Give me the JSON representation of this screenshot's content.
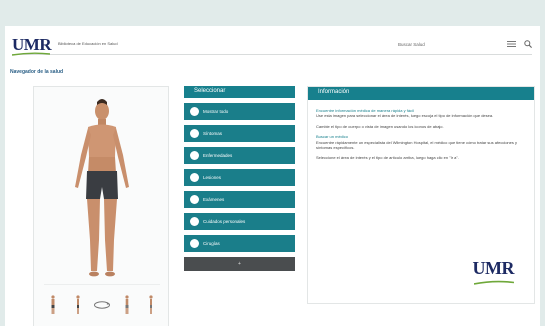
{
  "header": {
    "logo": "UMR",
    "tagline": "Biblioteca de Educación en Salud",
    "search_label": "Buscar Salud"
  },
  "breadcrumb": "Navegador de la salud",
  "selector": {
    "title": "Seleccionar",
    "items": [
      {
        "label": "Mostrar todo"
      },
      {
        "label": "Síntomas"
      },
      {
        "label": "Enfermedades"
      },
      {
        "label": "Lesiones"
      },
      {
        "label": "Exámenes"
      },
      {
        "label": "Cuidados personales"
      },
      {
        "label": "Cirugías"
      }
    ],
    "more": "+"
  },
  "info": {
    "title": "Información",
    "subtitle": "Encuentre información médica de manera rápida y fácil",
    "p1": "Use esta imagen para seleccionar el área de interés, luego escoja el tipo de información que desea.",
    "p2": "Cambie el tipo de cuerpo o vista de imagen usando los iconos de abajo.",
    "subtitle2": "Buscar un médico",
    "p3": "Encuentre rápidamente un especialista del Wilmington Hospital, el médico que tiene cómo tratar sus afecciones y síntomas específicos.",
    "p4": "Seleccione el área de interés y el tipo de artículo arriba, luego haga clic en \"Ir a\".",
    "logo": "UMR"
  },
  "colors": {
    "teal": "#17808d",
    "navy": "#1d2a63",
    "green": "#6fa83a",
    "background": "#e1ebea"
  }
}
